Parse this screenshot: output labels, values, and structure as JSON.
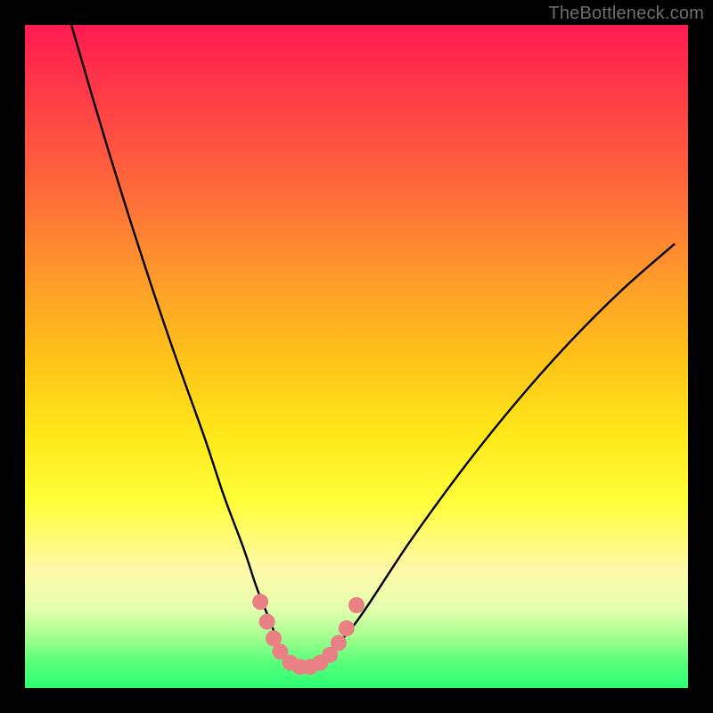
{
  "watermark": "TheBottleneck.com",
  "chart_data": {
    "type": "line",
    "title": "",
    "xlabel": "",
    "ylabel": "",
    "xlim": [
      0,
      100
    ],
    "ylim": [
      0,
      100
    ],
    "series": [
      {
        "name": "bottleneck-curve",
        "x": [
          7,
          12,
          17,
          22,
          27,
          30,
          33,
          35,
          37,
          38.5,
          40,
          41.5,
          43,
          45,
          50,
          58,
          66,
          74,
          82,
          90,
          98
        ],
        "y": [
          100,
          83,
          67,
          52,
          38,
          29,
          21,
          15,
          10,
          6,
          3.5,
          3,
          3,
          4.5,
          10,
          22,
          33,
          43,
          52,
          60,
          67
        ]
      }
    ],
    "markers": {
      "name": "highlight-dots",
      "color": "#e98084",
      "points": [
        {
          "x": 35.5,
          "y": 13
        },
        {
          "x": 36.5,
          "y": 10
        },
        {
          "x": 37.5,
          "y": 7.5
        },
        {
          "x": 38.5,
          "y": 5.5
        },
        {
          "x": 40,
          "y": 3.8
        },
        {
          "x": 41.5,
          "y": 3.2
        },
        {
          "x": 43,
          "y": 3.2
        },
        {
          "x": 44.5,
          "y": 3.8
        },
        {
          "x": 46,
          "y": 5
        },
        {
          "x": 47.3,
          "y": 6.8
        },
        {
          "x": 48.5,
          "y": 9
        },
        {
          "x": 50,
          "y": 12.5
        }
      ]
    },
    "gradient_stops": [
      {
        "pos": 0,
        "color": "#ff1a52"
      },
      {
        "pos": 50,
        "color": "#ffe81a"
      },
      {
        "pos": 100,
        "color": "#2aff74"
      }
    ]
  }
}
